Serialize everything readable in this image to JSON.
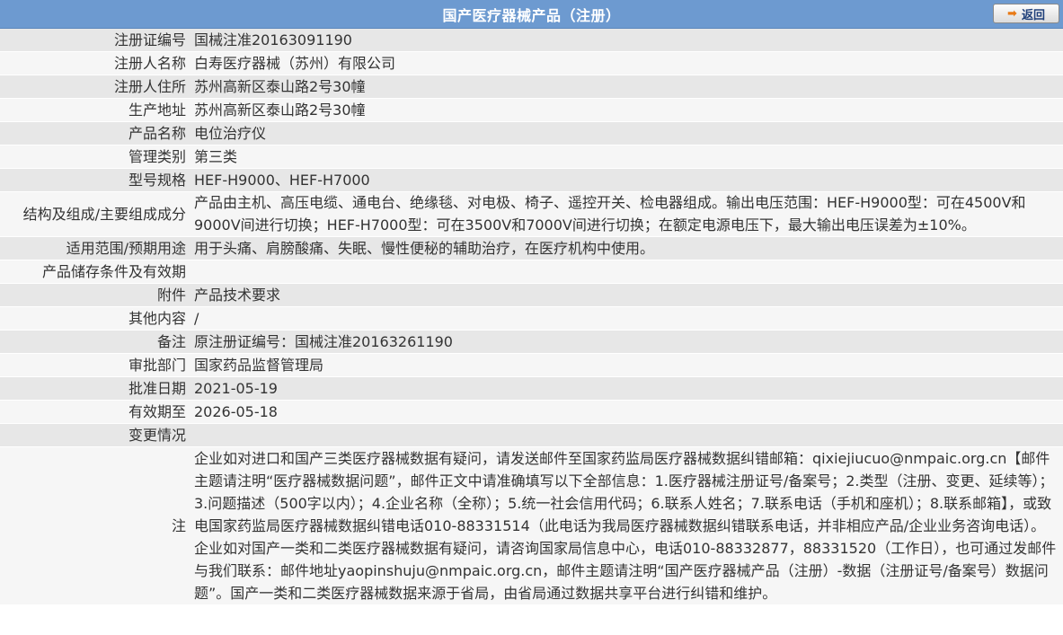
{
  "header": {
    "title": "国产医疗器械产品（注册）",
    "back_label": "返回",
    "back_icon": "arrow-right-icon"
  },
  "rows": [
    {
      "label": "注册证编号",
      "value": "国械注准20163091190"
    },
    {
      "label": "注册人名称",
      "value": "白寿医疗器械（苏州）有限公司"
    },
    {
      "label": "注册人住所",
      "value": "苏州高新区泰山路2号30幢"
    },
    {
      "label": "生产地址",
      "value": "苏州高新区泰山路2号30幢"
    },
    {
      "label": "产品名称",
      "value": "电位治疗仪"
    },
    {
      "label": "管理类别",
      "value": "第三类"
    },
    {
      "label": "型号规格",
      "value": "HEF-H9000、HEF-H7000"
    },
    {
      "label": "结构及组成/主要组成成分",
      "value": "产品由主机、高压电缆、通电台、绝缘毯、对电极、椅子、遥控开关、检电器组成。输出电压范围：HEF-H9000型：可在4500V和9000V间进行切换；HEF-H7000型：可在3500V和7000V间进行切换；在额定电源电压下，最大输出电压误差为±10%。"
    },
    {
      "label": "适用范围/预期用途",
      "value": "用于头痛、肩膀酸痛、失眠、慢性便秘的辅助治疗，在医疗机构中使用。"
    },
    {
      "label": "产品储存条件及有效期",
      "value": ""
    },
    {
      "label": "附件",
      "value": "产品技术要求"
    },
    {
      "label": "其他内容",
      "value": "/"
    },
    {
      "label": "备注",
      "value": "原注册证编号：国械注准20163261190"
    },
    {
      "label": "审批部门",
      "value": "国家药品监督管理局"
    },
    {
      "label": "批准日期",
      "value": "2021-05-19"
    },
    {
      "label": "有效期至",
      "value": "2026-05-18"
    },
    {
      "label": "变更情况",
      "value": ""
    }
  ],
  "notice": {
    "label": "注",
    "text": "企业如对进口和国产三类医疗器械数据有疑问，请发送邮件至国家药监局医疗器械数据纠错邮箱：qixiejiucuo@nmpaic.org.cn【邮件主题请注明“医疗器械数据问题”，邮件正文中请准确填写以下全部信息：1.医疗器械注册证号/备案号；2.类型（注册、变更、延续等）；3.问题描述（500字以内）；4.企业名称（全称）；5.统一社会信用代码；6.联系人姓名；7.联系电话（手机和座机）；8.联系邮箱】，或致电国家药监局医疗器械数据纠错电话010-88331514（此电话为我局医疗器械数据纠错联系电话，并非相应产品/企业业务咨询电话）。企业如对国产一类和二类医疗器械数据有疑问，请咨询国家局信息中心，电话010-88332877，88331520（工作日），也可通过发邮件与我们联系：邮件地址yaopinshuju@nmpaic.org.cn，邮件主题请注明“国产医疗器械产品（注册）-数据（注册证号/备案号）数据问题”。国产一类和二类医疗器械数据来源于省局，由省局通过数据共享平台进行纠错和维护。"
  },
  "colors": {
    "header_bg": "#6d9ad0",
    "row_odd": "#e7e7e7",
    "row_even": "#f6f6f6",
    "text": "#333333",
    "back_arrow": "#e87a17"
  }
}
